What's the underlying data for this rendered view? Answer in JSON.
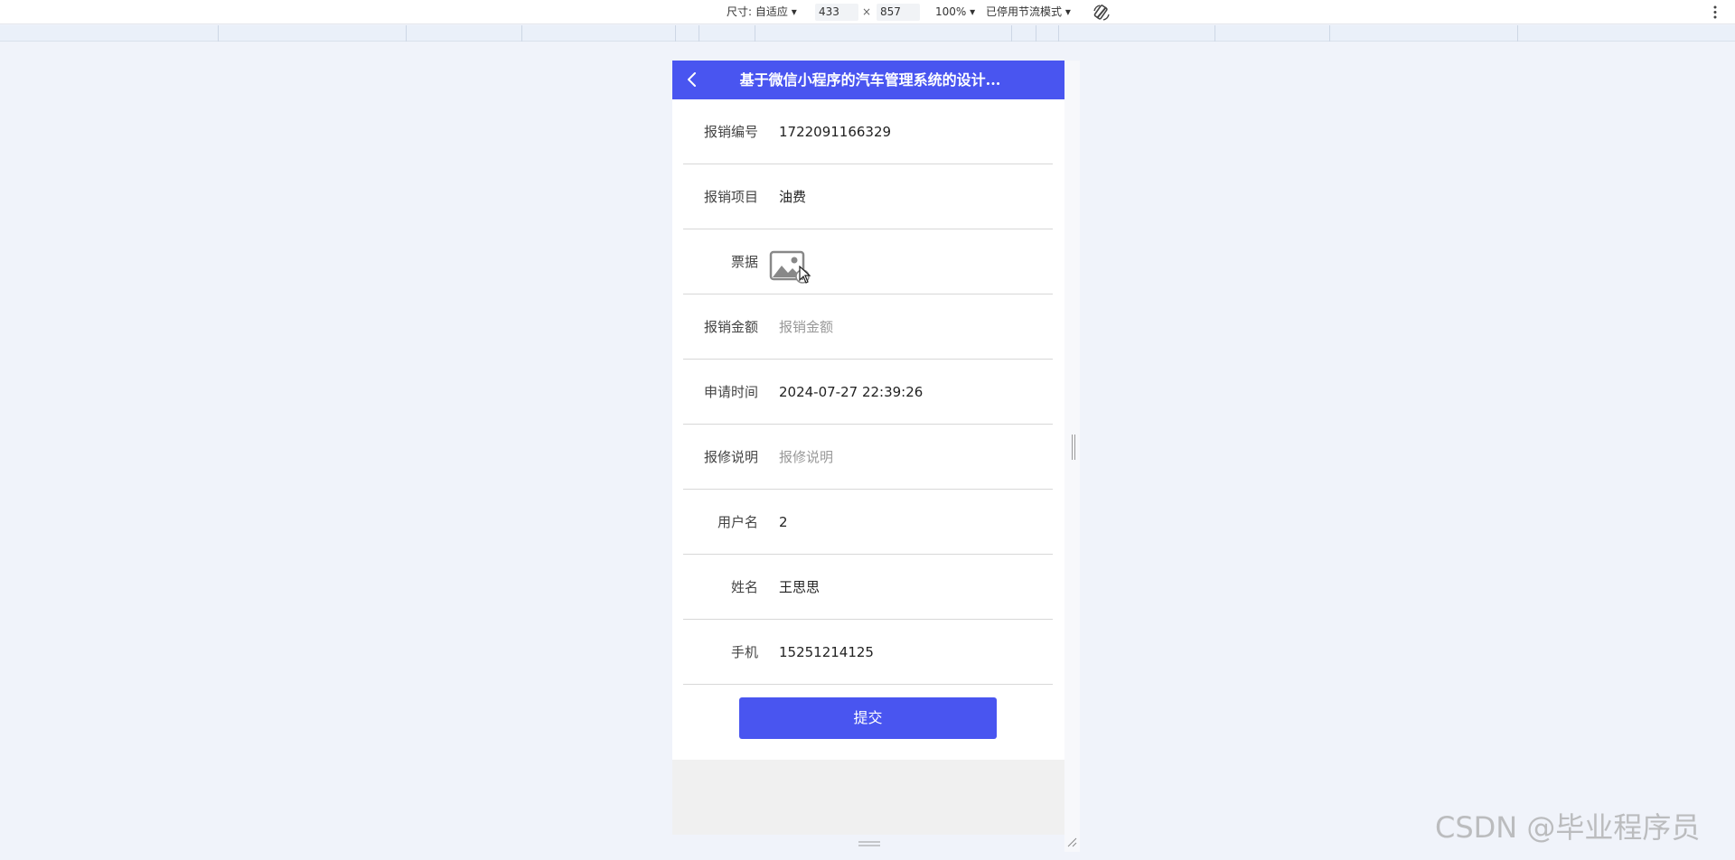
{
  "devtools": {
    "size_label": "尺寸: 自适应",
    "width": "433",
    "times": "×",
    "height": "857",
    "zoom": "100%",
    "throttle": "已停用节流模式",
    "dropdown_caret": "▾"
  },
  "header": {
    "title": "基于微信小程序的汽车管理系统的设计..."
  },
  "form": {
    "fields": [
      {
        "label": "报销编号",
        "value": "1722091166329",
        "placeholder": ""
      },
      {
        "label": "报销项目",
        "value": "油费",
        "placeholder": ""
      },
      {
        "label": "票据",
        "value": "",
        "placeholder": ""
      },
      {
        "label": "报销金额",
        "value": "",
        "placeholder": "报销金额"
      },
      {
        "label": "申请时间",
        "value": "2024-07-27 22:39:26",
        "placeholder": ""
      },
      {
        "label": "报修说明",
        "value": "",
        "placeholder": "报修说明"
      },
      {
        "label": "用户名",
        "value": "2",
        "placeholder": ""
      },
      {
        "label": "姓名",
        "value": "王思思",
        "placeholder": ""
      },
      {
        "label": "手机",
        "value": "15251214125",
        "placeholder": ""
      }
    ],
    "submit_label": "提交"
  },
  "icons": {
    "back": "chevron-left-icon",
    "upload": "image-upload-icon",
    "cursor": "mouse-cursor-icon",
    "rotate": "rotate-icon",
    "menu": "kebab-menu-icon"
  },
  "colors": {
    "primary": "#4955f0",
    "page_bg": "#f0f3fa"
  },
  "watermark": "CSDN @毕业程序员"
}
